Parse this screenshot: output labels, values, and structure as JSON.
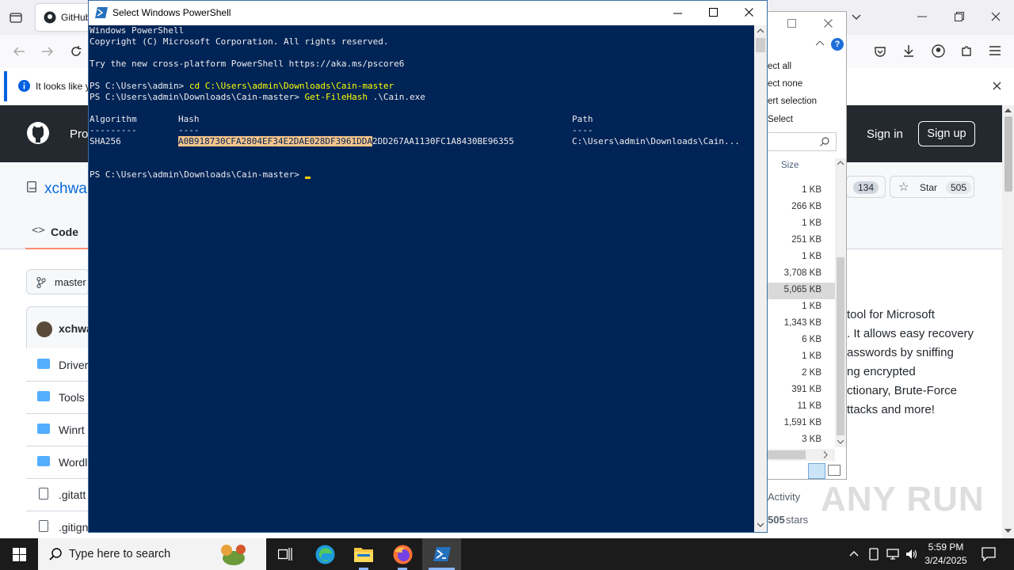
{
  "browser": {
    "tab_title": "GitHub",
    "notification": "It looks like y",
    "gh": {
      "repo_owner": "xchwa",
      "tab_code": "Code",
      "branch": "master",
      "commit_author": "xchwa",
      "product_partial": "Pro",
      "sign_in": "Sign in",
      "sign_up": "Sign up",
      "fork_count": "134",
      "star_label": "Star",
      "star_count": "505",
      "files": [
        {
          "type": "folder",
          "name": "Driver"
        },
        {
          "type": "folder",
          "name": "Tools"
        },
        {
          "type": "folder",
          "name": "Winrt"
        },
        {
          "type": "folder",
          "name": "Wordl"
        },
        {
          "type": "file",
          "name": ".gitatt"
        },
        {
          "type": "file",
          "name": ".gitign"
        }
      ],
      "about": [
        "tool for Microsoft",
        ". It allows easy recovery",
        "asswords by sniffing",
        "ng encrypted",
        "ctionary, Brute-Force",
        "ttacks and more!"
      ],
      "activity": "Activity",
      "stars_count": "505",
      "stars_label": "stars"
    }
  },
  "explorer": {
    "menu": [
      "ect all",
      "ect none",
      "ert selection",
      "Select"
    ],
    "size_header": "Size",
    "sizes": [
      "1 KB",
      "266 KB",
      "1 KB",
      "251 KB",
      "1 KB",
      "3,708 KB",
      "5,065 KB",
      "1 KB",
      "1,343 KB",
      "6 KB",
      "1 KB",
      "2 KB",
      "391 KB",
      "11 KB",
      "1,591 KB",
      "3 KB"
    ],
    "selected_index": 6
  },
  "powershell": {
    "title": "Select Windows PowerShell",
    "lines": {
      "l1": "Windows PowerShell",
      "l2": "Copyright (C) Microsoft Corporation. All rights reserved.",
      "l3": "Try the new cross-platform PowerShell https://aka.ms/pscore6",
      "prompt1": "PS C:\\Users\\admin> ",
      "cmd1": "cd C:\\Users\\admin\\Downloads\\Cain-master",
      "prompt2": "PS C:\\Users\\admin\\Downloads\\Cain-master> ",
      "cmd2": "Get-FileHash",
      "cmd2_arg": " .\\Cain.exe",
      "hdr_algorithm": "Algorithm",
      "hdr_hash": "Hash",
      "hdr_path": "Path",
      "sep_algorithm": "---------",
      "sep_hash": "----",
      "sep_path": "----",
      "algo": "SHA256",
      "hash_selected": "A0B918730CFA2804EF34E2DAE028DF3961DDA",
      "hash_rest": "2DD267AA1130FC1A8430BE96355",
      "path": "C:\\Users\\admin\\Downloads\\Cain...",
      "prompt3": "PS C:\\Users\\admin\\Downloads\\Cain-master> "
    }
  },
  "taskbar": {
    "search_placeholder": "Type here to search",
    "time": "5:59 PM",
    "date": "3/24/2025"
  },
  "watermark": "ANY RUN",
  "colors": {
    "console_bg": "#012456",
    "selection": "#f5c48a",
    "github_header": "#24292f"
  }
}
